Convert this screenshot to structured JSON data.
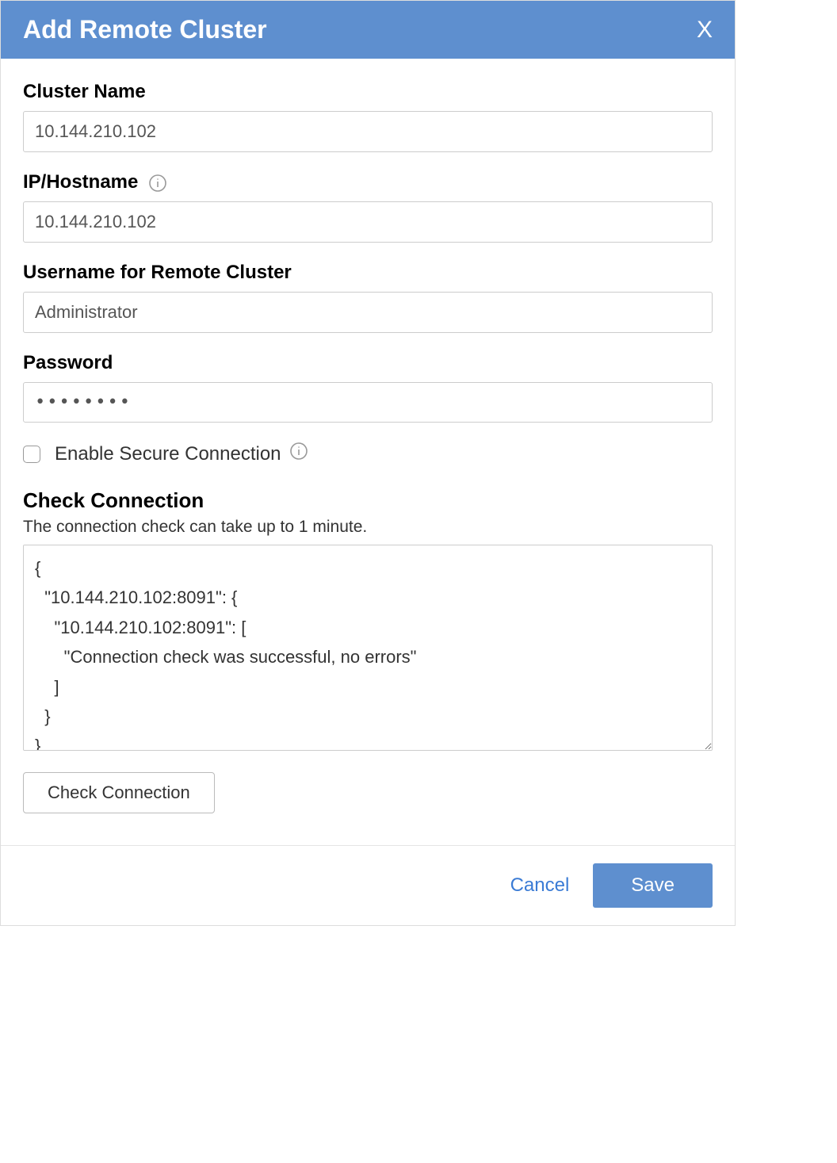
{
  "dialog": {
    "title": "Add Remote Cluster",
    "close_glyph": "X"
  },
  "form": {
    "cluster_name": {
      "label": "Cluster Name",
      "value": "10.144.210.102"
    },
    "ip_hostname": {
      "label": "IP/Hostname",
      "value": "10.144.210.102"
    },
    "username": {
      "label": "Username for Remote Cluster",
      "value": "Administrator"
    },
    "password": {
      "label": "Password",
      "value": "••••••••"
    },
    "secure_connection": {
      "label": "Enable Secure Connection",
      "checked": false
    }
  },
  "check_connection": {
    "heading": "Check Connection",
    "subtext": "The connection check can take up to 1 minute.",
    "result": "{\n  \"10.144.210.102:8091\": {\n    \"10.144.210.102:8091\": [\n      \"Connection check was successful, no errors\"\n    ]\n  }\n}",
    "button_label": "Check Connection"
  },
  "footer": {
    "cancel": "Cancel",
    "save": "Save"
  }
}
